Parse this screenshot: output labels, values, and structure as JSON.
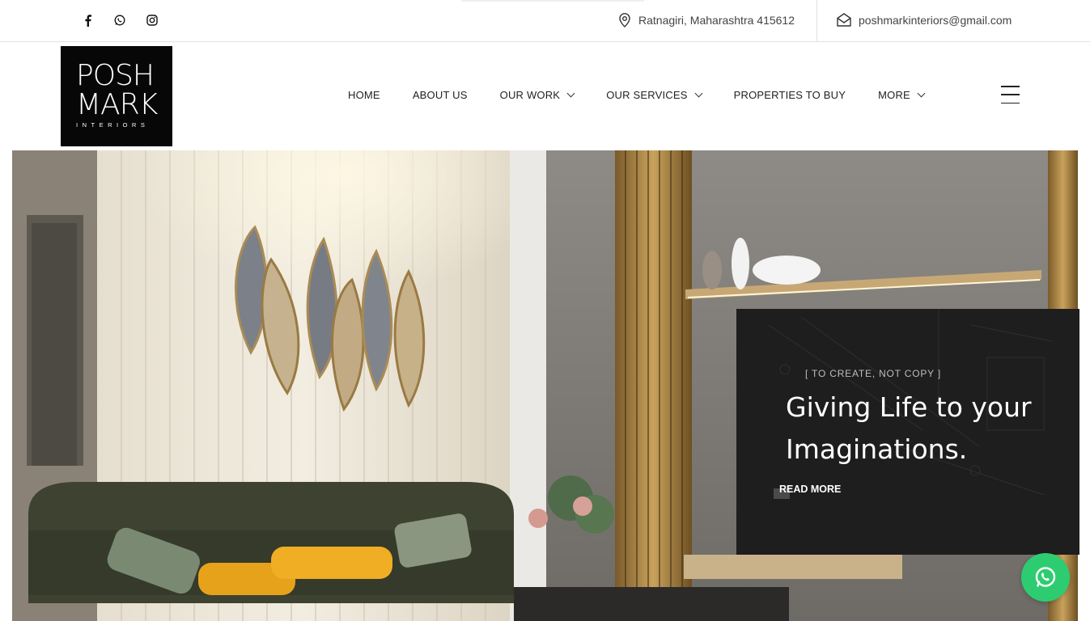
{
  "topbar": {
    "social_icons": [
      "facebook-icon",
      "whatsapp-icon",
      "instagram-icon"
    ],
    "location": "Ratnagiri, Maharashtra 415612",
    "email": "poshmarkinteriors@gmail.com"
  },
  "logo": {
    "line1": "POSH",
    "line2": "MARK",
    "line3": "INTERIORS"
  },
  "nav": {
    "items": [
      {
        "label": "HOME",
        "has_dropdown": false
      },
      {
        "label": "ABOUT US",
        "has_dropdown": false
      },
      {
        "label": "OUR WORK",
        "has_dropdown": true
      },
      {
        "label": "OUR SERVICES",
        "has_dropdown": true
      },
      {
        "label": "PROPERTIES TO BUY",
        "has_dropdown": false
      },
      {
        "label": "MORE",
        "has_dropdown": true
      }
    ]
  },
  "hero": {
    "kicker": "[ TO CREATE, NOT COPY ]",
    "headline": "Giving Life to your Imaginations.",
    "cta": "READ MORE"
  },
  "colors": {
    "accent_whatsapp": "#2ecc71",
    "card_bg": "#1e1e1e",
    "logo_bg": "#070707"
  }
}
